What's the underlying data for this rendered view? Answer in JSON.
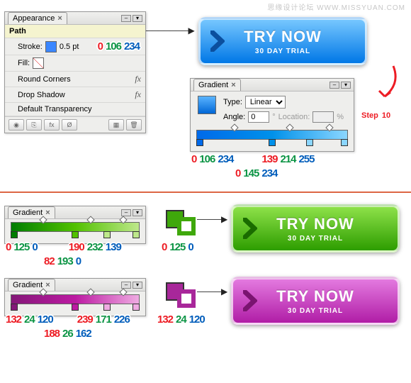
{
  "watermark": "思缘设计论坛  WWW.MISSYUAN.COM",
  "step": {
    "label": "Step",
    "num": "10"
  },
  "appearance": {
    "tab": "Appearance",
    "path": "Path",
    "stroke_label": "Stroke:",
    "stroke_val": "0.5 pt",
    "fill_label": "Fill:",
    "round": "Round Corners",
    "shadow": "Drop Shadow",
    "transp": "Default Transparency",
    "rgb1": [
      "0",
      "106",
      "234"
    ]
  },
  "gradient": {
    "tab": "Gradient",
    "type": "Type:",
    "type_val": "Linear",
    "angle": "Angle:",
    "angle_val": "0",
    "loc": "Location:",
    "loc_val": "",
    "pct": "%",
    "stops": [
      {
        "pos": 0,
        "rgb": [
          "0",
          "106",
          "234"
        ]
      },
      {
        "pos": 50,
        "rgb": [
          "0",
          "145",
          "234"
        ]
      },
      {
        "pos": 75,
        "rgb": [
          "139",
          "214",
          "255"
        ]
      }
    ]
  },
  "try": {
    "title": "TRY NOW",
    "sub": "30 DAY TRIAL"
  },
  "g2": {
    "tab": "Gradient",
    "stops": [
      {
        "pos": 0,
        "rgb": [
          "0",
          "125",
          "0"
        ]
      },
      {
        "pos": 50,
        "rgb": [
          "82",
          "193",
          "0"
        ]
      },
      {
        "pos": 100,
        "rgb": [
          "190",
          "232",
          "139"
        ]
      }
    ],
    "pair": [
      "0",
      "125",
      "0"
    ]
  },
  "g3": {
    "tab": "Gradient",
    "stops": [
      {
        "pos": 0,
        "rgb": [
          "132",
          "24",
          "120"
        ]
      },
      {
        "pos": 50,
        "rgb": [
          "188",
          "26",
          "162"
        ]
      },
      {
        "pos": 100,
        "rgb": [
          "239",
          "171",
          "226"
        ]
      }
    ],
    "pair": [
      "132",
      "24",
      "120"
    ]
  }
}
